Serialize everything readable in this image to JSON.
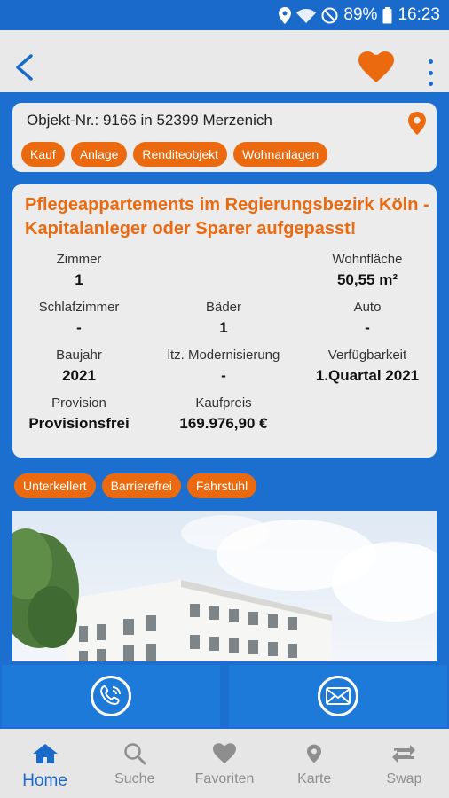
{
  "statusbar": {
    "battery": "89%",
    "time": "16:23"
  },
  "colors": {
    "accent": "#ec6a0f",
    "primary": "#1a6acb",
    "card": "#ececec"
  },
  "header": {
    "back_icon": "back-arrow-icon",
    "favorite_icon": "heart-icon",
    "menu_icon": "more-vert-icon"
  },
  "object": {
    "id_line": "Objekt-Nr.: 9166 in 52399 Merzenich",
    "tags": [
      "Kauf",
      "Anlage",
      "Renditeobjekt",
      "Wohnanlagen"
    ]
  },
  "details": {
    "title": "Pflegeappartements im Regierungsbezirk Köln - Kapitalanleger oder Sparer aufgepasst!",
    "rooms": {
      "label": "Zimmer",
      "value": "1"
    },
    "living_area": {
      "label": "Wohnfläche",
      "value": "50,55 m²"
    },
    "bedrooms": {
      "label": "Schlafzimmer",
      "value": "-"
    },
    "bathrooms": {
      "label": "Bäder",
      "value": "1"
    },
    "car": {
      "label": "Auto",
      "value": "-"
    },
    "year_built": {
      "label": "Baujahr",
      "value": "2021"
    },
    "modernization": {
      "label": "ltz. Modernisierung",
      "value": "-"
    },
    "availability": {
      "label": "Verfügbarkeit",
      "value": "1.Quartal 2021"
    },
    "commission": {
      "label": "Provision",
      "value": "Provisionsfrei"
    },
    "price": {
      "label": "Kaufpreis",
      "value": "169.976,90 €"
    }
  },
  "features": [
    "Unterkellert",
    "Barrierefrei",
    "Fahrstuhl"
  ],
  "actions": {
    "call_icon": "phone-icon",
    "mail_icon": "mail-icon"
  },
  "tabs": [
    {
      "label": "Home",
      "icon": "home-icon"
    },
    {
      "label": "Suche",
      "icon": "search-icon"
    },
    {
      "label": "Favoriten",
      "icon": "heart-icon"
    },
    {
      "label": "Karte",
      "icon": "map-pin-icon"
    },
    {
      "label": "Swap",
      "icon": "swap-icon"
    }
  ]
}
